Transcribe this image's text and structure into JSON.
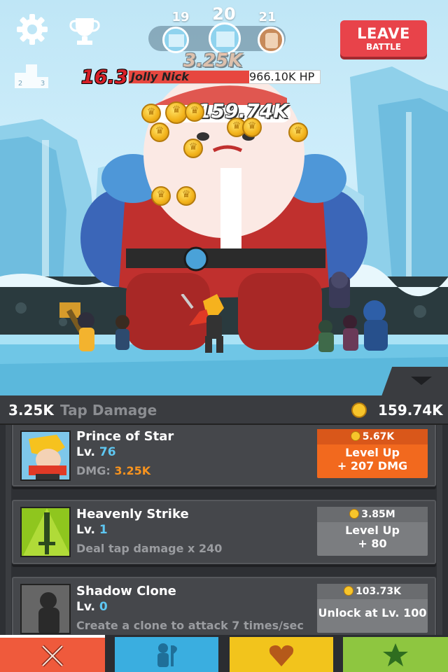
{
  "stage": {
    "prev": "19",
    "current": "20",
    "next": "21"
  },
  "leave_button": {
    "label": "LEAVE",
    "sublabel": "BATTLE"
  },
  "boss": {
    "timer": "16.3",
    "name": "Jolly Nick",
    "hp_text": "966.10K HP",
    "hp_fraction": 0.63
  },
  "floating_damage": {
    "primary": "159.74K",
    "secondary": "3.25K"
  },
  "stats": {
    "tap_damage_value": "3.25K",
    "tap_damage_label": "Tap Damage",
    "gold": "159.74K"
  },
  "cards": [
    {
      "title": "Prince of Star",
      "level_label": "Lv.",
      "level": "76",
      "desc_label": "DMG:",
      "desc_value": "3.25K",
      "cost": "5.67K",
      "button_line1": "Level Up",
      "button_line2": "+ 207 DMG",
      "button_color": "#f2691e"
    },
    {
      "title": "Heavenly Strike",
      "level_label": "Lv.",
      "level": "1",
      "desc": "Deal tap damage x 240",
      "cost": "3.85M",
      "button_line1": "Level Up",
      "button_line2": "+ 80",
      "button_color": "#7b7d80"
    },
    {
      "title": "Shadow Clone",
      "level_label": "Lv.",
      "level": "0",
      "desc": "Create a clone to attack 7 times/sec",
      "cost": "103.73K",
      "button_line1": "Unlock at Lv. 100",
      "button_color": "#7b7d80"
    }
  ],
  "nav": [
    {
      "name": "sword",
      "icon": "crossed-swords-icon",
      "color": "#ef5a3c"
    },
    {
      "name": "heroes",
      "icon": "hero-axe-icon",
      "color": "#3aaee0"
    },
    {
      "name": "artifacts",
      "icon": "heart-shield-icon",
      "color": "#f2c41c"
    },
    {
      "name": "shop",
      "icon": "star-icon",
      "color": "#8ec640"
    }
  ]
}
